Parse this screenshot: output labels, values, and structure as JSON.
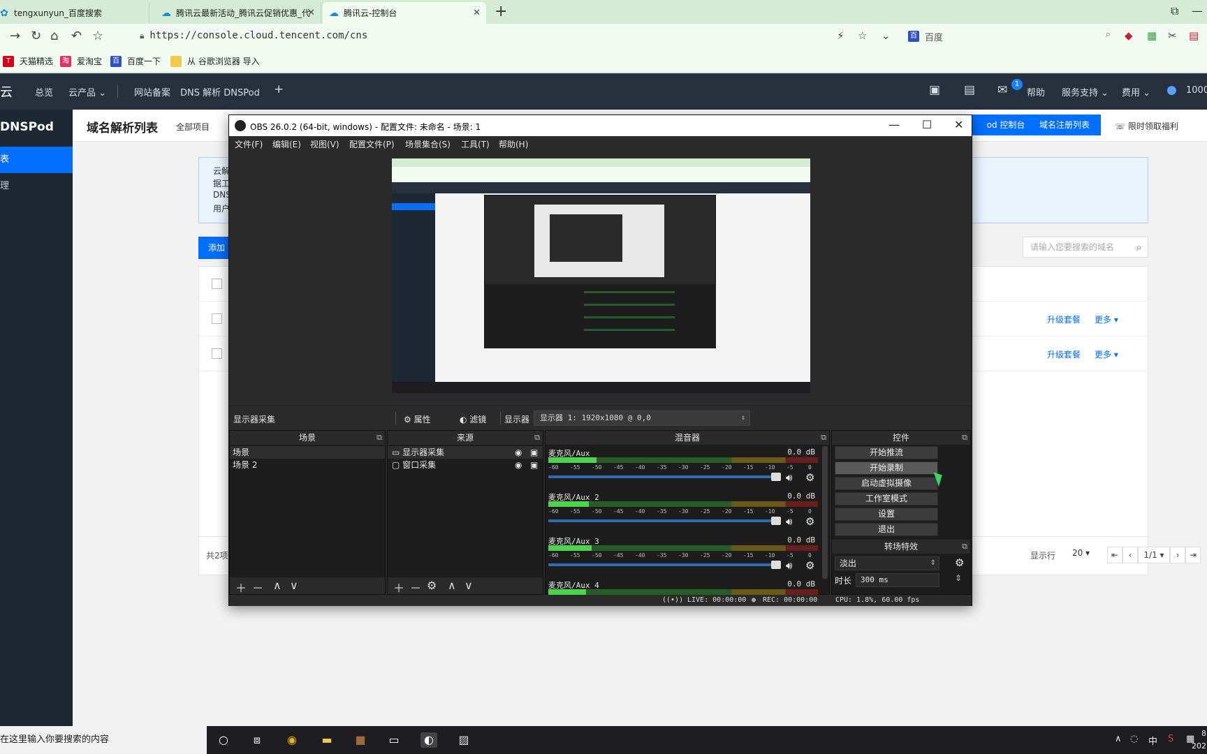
{
  "browser": {
    "tabs": [
      {
        "title": "tengxunyun_百度搜索"
      },
      {
        "title": "腾讯云最新活动_腾讯云促销优惠_代"
      },
      {
        "title": "腾讯云-控制台"
      }
    ],
    "url": "https://console.cloud.tencent.com/cns",
    "search_engine": "百度",
    "bookmarks": [
      "天猫精选",
      "爱淘宝",
      "百度一下",
      "从 谷歌浏览器 导入"
    ]
  },
  "console": {
    "brand": "云",
    "nav_left": [
      "总览",
      "云产品 ⌄",
      "网站备案",
      "DNS 解析 DNSPod"
    ],
    "nav_plus": "+",
    "nav_right": [
      "帮助",
      "服务支持 ⌄",
      "费用 ⌄",
      "1000"
    ],
    "message_badge": "1",
    "sidebar": {
      "title": "DNSPod",
      "items": [
        "表",
        "理"
      ]
    },
    "page_title": "域名解析列表",
    "project_filter": "全部项目",
    "header_buttons": [
      "od 控制台",
      "域名注册列表"
    ],
    "gift_link": "限时领取福利",
    "notice_lines": [
      "云解",
      "据工",
      "DNS",
      "用户"
    ],
    "add_button": "添加",
    "search_placeholder": "请输入您要搜索的域名",
    "row_actions": [
      "升级套餐",
      "更多 ▾"
    ],
    "footer": {
      "total": "共2项",
      "per_page_label": "显示行",
      "per_page": "20 ▾",
      "page": "1/1 ▾"
    }
  },
  "obs": {
    "title": "OBS 26.0.2 (64-bit, windows) - 配置文件: 未命名 - 场景: 1",
    "menu": [
      "文件(F)",
      "编辑(E)",
      "视图(V)",
      "配置文件(P)",
      "场景集合(S)",
      "工具(T)",
      "帮助(H)"
    ],
    "toolbar": {
      "source_name": "显示器采集",
      "properties": "属性",
      "filters": "滤镜",
      "display_label": "显示器",
      "display_value": "显示器 1: 1920x1080 @ 0,0"
    },
    "docks": {
      "scenes": {
        "title": "场景",
        "items": [
          "场景",
          "场景 2"
        ]
      },
      "sources": {
        "title": "来源",
        "items": [
          "显示器采集",
          "窗口采集"
        ]
      },
      "mixer": {
        "title": "混音器",
        "channels": [
          {
            "name": "麦克风/Aux",
            "db": "0.0 dB",
            "level": 0.18,
            "volume": 0.95
          },
          {
            "name": "麦克风/Aux 2",
            "db": "0.0 dB",
            "level": 0.15,
            "volume": 0.95
          },
          {
            "name": "麦克风/Aux 3",
            "db": "0.0 dB",
            "level": 0.16,
            "volume": 0.95
          },
          {
            "name": "麦克风/Aux 4",
            "db": "0.0 dB",
            "level": 0.14,
            "volume": 0.95
          }
        ],
        "scale": [
          "-60",
          "-55",
          "-50",
          "-45",
          "-40",
          "-35",
          "-30",
          "-25",
          "-20",
          "-15",
          "-10",
          "-5",
          "0"
        ]
      },
      "controls": {
        "title": "控件",
        "buttons": [
          "开始推流",
          "开始录制",
          "启动虚拟摄像",
          "工作室模式",
          "设置",
          "退出"
        ],
        "transition_title": "转场特效",
        "transition": "淡出",
        "duration_label": "时长",
        "duration": "300 ms"
      }
    },
    "status": {
      "live": "LIVE: 00:00:00",
      "rec": "REC: 00:00:00",
      "cpu": "CPU: 1.8%, 60.00 fps"
    }
  },
  "taskbar": {
    "search_text": "在这里输入你要搜索的内容",
    "tray_ime": "中",
    "clock_fragment": "8",
    "date_fragment": "202"
  }
}
